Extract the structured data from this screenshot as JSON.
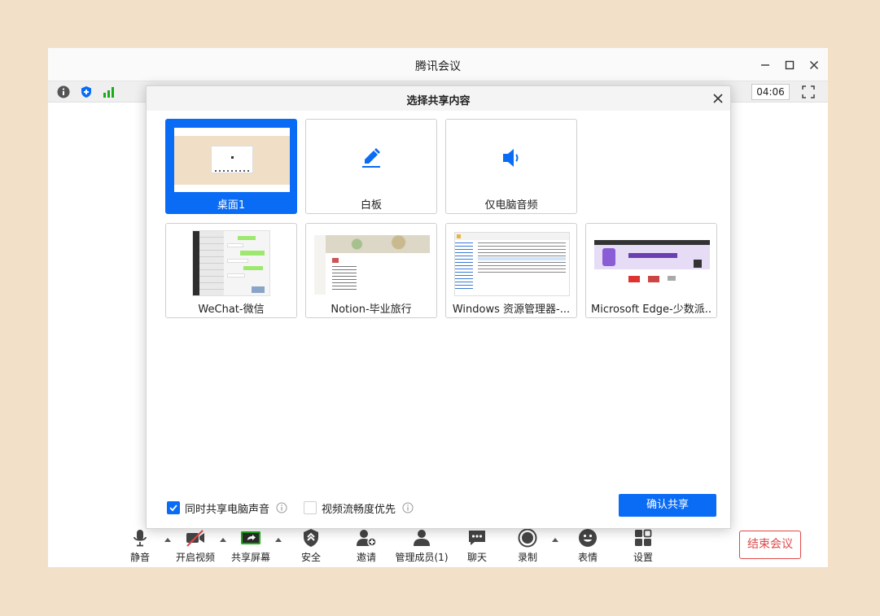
{
  "app": {
    "title": "腾讯会议",
    "timer": "04:06"
  },
  "colors": {
    "accent": "#0a6cf5",
    "danger": "#e04848",
    "signal": "#1aad19",
    "background": "#f2e0c9"
  },
  "icons": {
    "window_controls": [
      "minimize-icon",
      "maximize-icon",
      "close-icon"
    ],
    "info_bar": [
      "info-icon",
      "shield-icon",
      "signal-icon",
      "fullscreen-icon"
    ]
  },
  "dialog": {
    "title": "选择共享内容",
    "tiles": [
      {
        "label": "桌面1",
        "selected": true,
        "kind": "desktop-thumbnail"
      },
      {
        "label": "白板",
        "selected": false,
        "kind": "pen-icon"
      },
      {
        "label": "仅电脑音频",
        "selected": false,
        "kind": "speaker-icon"
      },
      {
        "label": "WeChat-微信",
        "selected": false,
        "kind": "wechat-thumbnail"
      },
      {
        "label": "Notion-毕业旅行",
        "selected": false,
        "kind": "notion-thumbnail"
      },
      {
        "label": "Windows 资源管理器-...",
        "selected": false,
        "kind": "explorer-thumbnail"
      },
      {
        "label": "Microsoft Edge-少数派...",
        "selected": false,
        "kind": "edge-thumbnail"
      }
    ],
    "options": [
      {
        "label": "同时共享电脑声音",
        "checked": true
      },
      {
        "label": "视频流畅度优先",
        "checked": false
      }
    ],
    "confirm_label": "确认共享"
  },
  "toolbar": {
    "items": [
      {
        "label": "静音",
        "icon": "microphone-icon"
      },
      {
        "label": "开启视频",
        "icon": "video-off-icon"
      },
      {
        "label": "共享屏幕",
        "icon": "share-screen-icon"
      },
      {
        "label": "安全",
        "icon": "security-icon"
      },
      {
        "label": "邀请",
        "icon": "invite-icon"
      },
      {
        "label": "管理成员(1)",
        "icon": "members-icon"
      },
      {
        "label": "聊天",
        "icon": "chat-icon"
      },
      {
        "label": "录制",
        "icon": "record-icon"
      },
      {
        "label": "表情",
        "icon": "emoji-icon"
      },
      {
        "label": "设置",
        "icon": "settings-icon"
      }
    ],
    "end_label": "结束会议"
  }
}
